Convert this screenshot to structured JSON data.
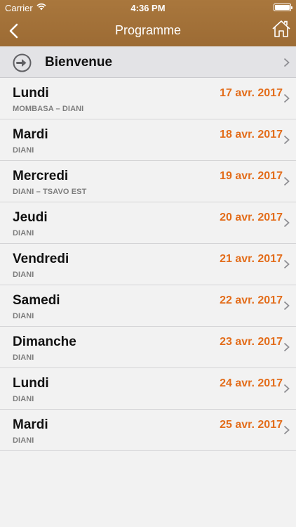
{
  "status_bar": {
    "carrier": "Carrier",
    "time": "4:36 PM"
  },
  "nav": {
    "title": "Programme",
    "back_icon": "chevron-left-icon",
    "home_icon": "home-icon"
  },
  "welcome": {
    "label": "Bienvenue",
    "icon": "arrow-circle-right-icon"
  },
  "colors": {
    "header": "#a2713a",
    "date": "#e36d1b",
    "background": "#f2f2f2"
  },
  "days": [
    {
      "day": "Lundi",
      "place": "MOMBASA – DIANI",
      "date": "17 avr. 2017"
    },
    {
      "day": "Mardi",
      "place": "DIANI",
      "date": "18 avr. 2017"
    },
    {
      "day": "Mercredi",
      "place": "DIANI – TSAVO EST",
      "date": "19 avr. 2017"
    },
    {
      "day": "Jeudi",
      "place": "DIANI",
      "date": "20 avr. 2017"
    },
    {
      "day": "Vendredi",
      "place": "DIANI",
      "date": "21 avr. 2017"
    },
    {
      "day": "Samedi",
      "place": "DIANI",
      "date": "22 avr. 2017"
    },
    {
      "day": "Dimanche",
      "place": "DIANI",
      "date": "23 avr. 2017"
    },
    {
      "day": "Lundi",
      "place": "DIANI",
      "date": "24 avr. 2017"
    },
    {
      "day": "Mardi",
      "place": "DIANI",
      "date": "25 avr. 2017"
    }
  ]
}
